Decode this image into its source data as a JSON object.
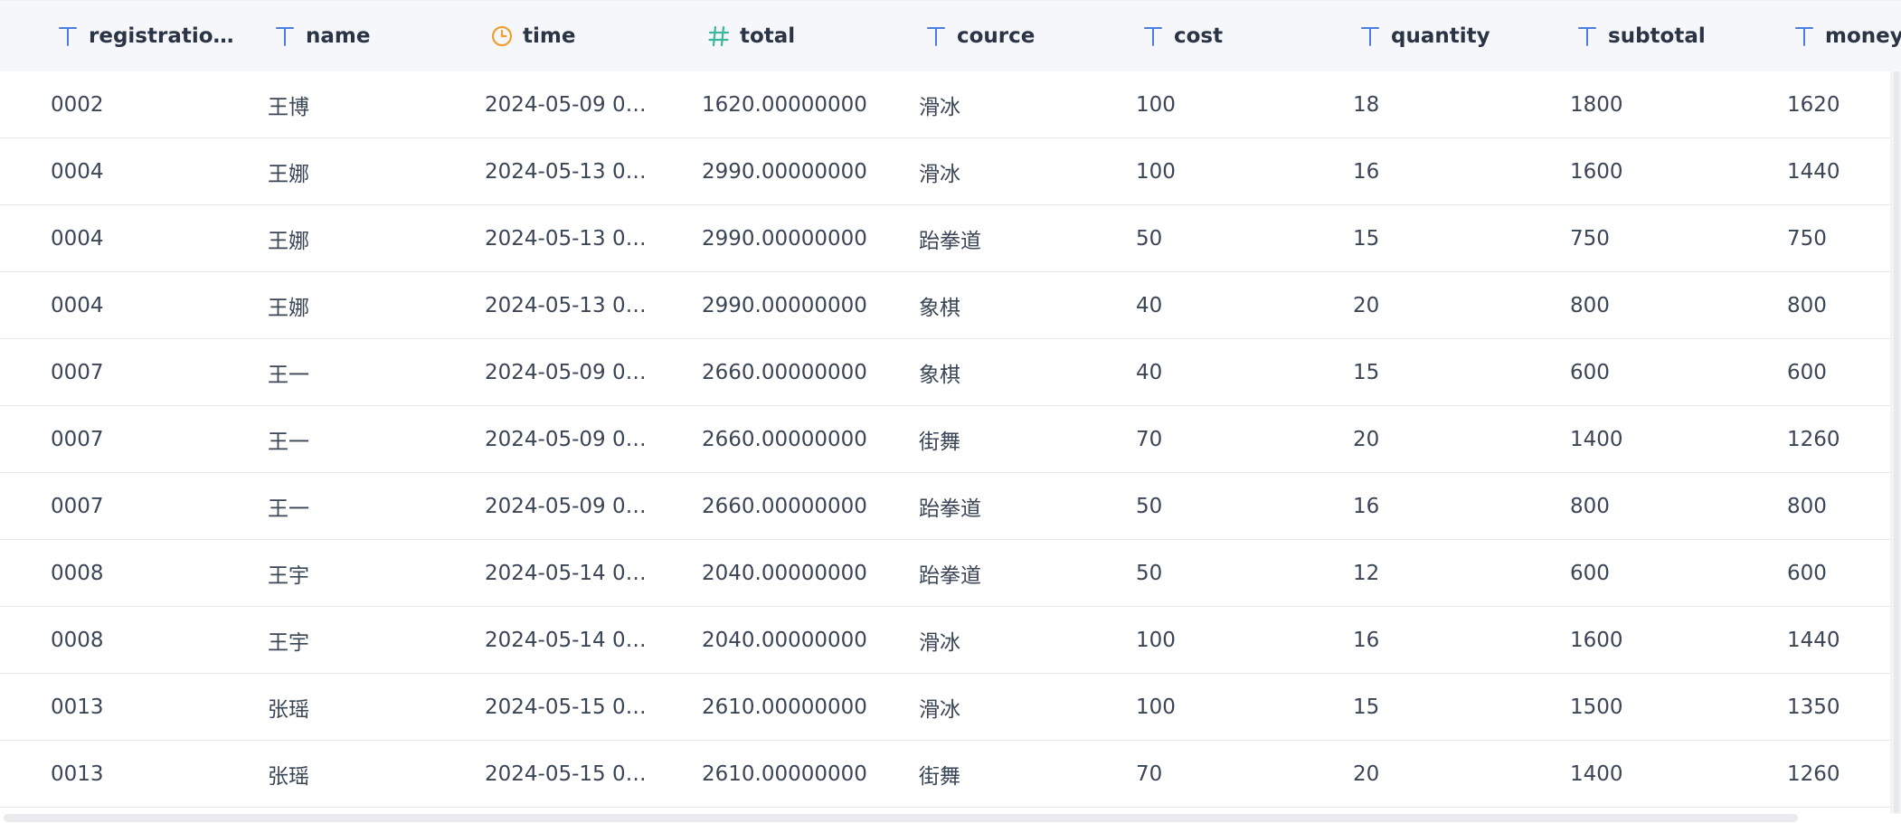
{
  "colors": {
    "text_type_icon": "#4a7fe0",
    "time_icon": "#f0a030",
    "number_icon": "#3bb89a",
    "header_bg": "#f5f7fa",
    "row_divider": "#e4e7ec"
  },
  "columns": [
    {
      "key": "registration",
      "label": "registratio…",
      "icon": "text-type-icon"
    },
    {
      "key": "name",
      "label": "name",
      "icon": "text-type-icon"
    },
    {
      "key": "time",
      "label": "time",
      "icon": "clock-icon"
    },
    {
      "key": "total",
      "label": "total",
      "icon": "number-hash-icon"
    },
    {
      "key": "cource",
      "label": "cource",
      "icon": "text-type-icon"
    },
    {
      "key": "cost",
      "label": "cost",
      "icon": "text-type-icon"
    },
    {
      "key": "quantity",
      "label": "quantity",
      "icon": "text-type-icon"
    },
    {
      "key": "subtotal",
      "label": "subtotal",
      "icon": "text-type-icon"
    },
    {
      "key": "money",
      "label": "money",
      "icon": "text-type-icon"
    }
  ],
  "rows": [
    [
      "0002",
      "王博",
      "2024-05-09 0…",
      "1620.00000000",
      "滑冰",
      "100",
      "18",
      "1800",
      "1620"
    ],
    [
      "0004",
      "王娜",
      "2024-05-13 0…",
      "2990.00000000",
      "滑冰",
      "100",
      "16",
      "1600",
      "1440"
    ],
    [
      "0004",
      "王娜",
      "2024-05-13 0…",
      "2990.00000000",
      "跆拳道",
      "50",
      "15",
      "750",
      "750"
    ],
    [
      "0004",
      "王娜",
      "2024-05-13 0…",
      "2990.00000000",
      "象棋",
      "40",
      "20",
      "800",
      "800"
    ],
    [
      "0007",
      "王一",
      "2024-05-09 0…",
      "2660.00000000",
      "象棋",
      "40",
      "15",
      "600",
      "600"
    ],
    [
      "0007",
      "王一",
      "2024-05-09 0…",
      "2660.00000000",
      "街舞",
      "70",
      "20",
      "1400",
      "1260"
    ],
    [
      "0007",
      "王一",
      "2024-05-09 0…",
      "2660.00000000",
      "跆拳道",
      "50",
      "16",
      "800",
      "800"
    ],
    [
      "0008",
      "王宇",
      "2024-05-14 0…",
      "2040.00000000",
      "跆拳道",
      "50",
      "12",
      "600",
      "600"
    ],
    [
      "0008",
      "王宇",
      "2024-05-14 0…",
      "2040.00000000",
      "滑冰",
      "100",
      "16",
      "1600",
      "1440"
    ],
    [
      "0013",
      "张瑶",
      "2024-05-15 0…",
      "2610.00000000",
      "滑冰",
      "100",
      "15",
      "1500",
      "1350"
    ],
    [
      "0013",
      "张瑶",
      "2024-05-15 0…",
      "2610.00000000",
      "街舞",
      "70",
      "20",
      "1400",
      "1260"
    ]
  ]
}
